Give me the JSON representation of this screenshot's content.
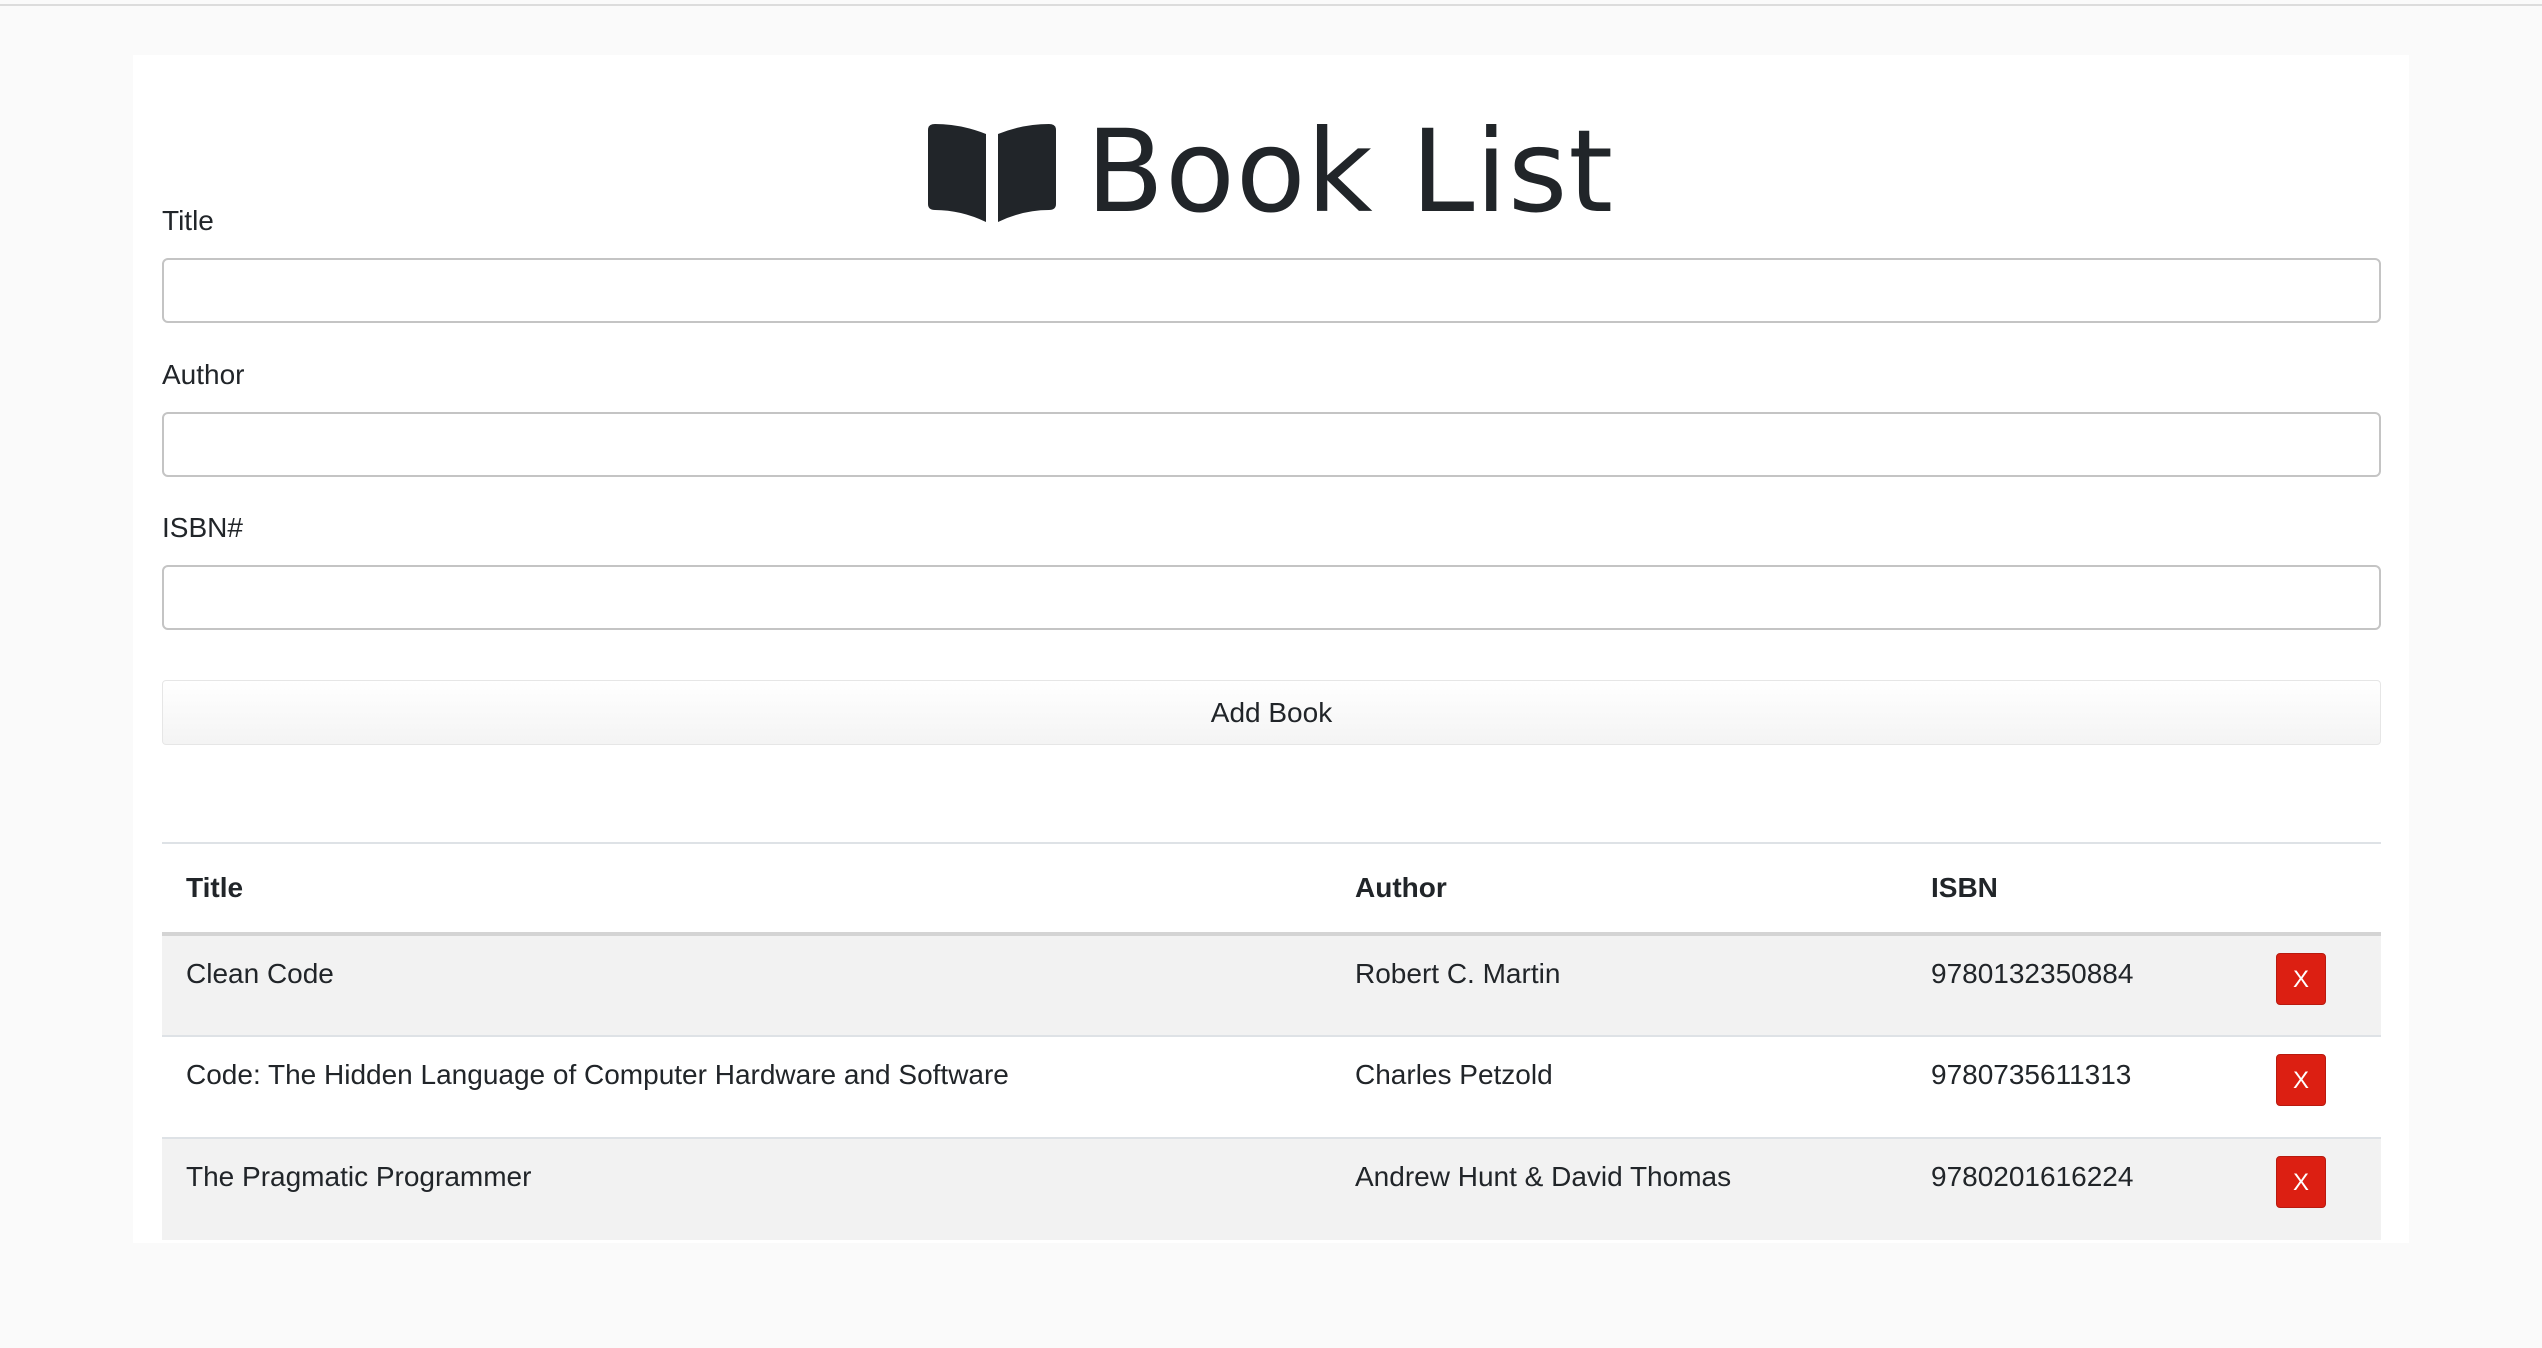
{
  "header": {
    "title": "Book List",
    "icon": "book-open-icon"
  },
  "form": {
    "title_label": "Title",
    "title_value": "",
    "author_label": "Author",
    "author_value": "",
    "isbn_label": "ISBN#",
    "isbn_value": "",
    "submit_label": "Add Book"
  },
  "table": {
    "columns": [
      "Title",
      "Author",
      "ISBN",
      ""
    ],
    "rows": [
      {
        "title": "Clean Code",
        "author": "Robert C. Martin",
        "isbn": "9780132350884",
        "delete_label": "X"
      },
      {
        "title": "Code: The Hidden Language of Computer Hardware and Software",
        "author": "Charles Petzold",
        "isbn": "9780735611313",
        "delete_label": "X"
      },
      {
        "title": "The Pragmatic Programmer",
        "author": "Andrew Hunt & David Thomas",
        "isbn": "9780201616224",
        "delete_label": "X"
      }
    ]
  },
  "colors": {
    "delete_button": "#dc1f12",
    "stripe": "#f2f2f2",
    "text": "#212529"
  }
}
